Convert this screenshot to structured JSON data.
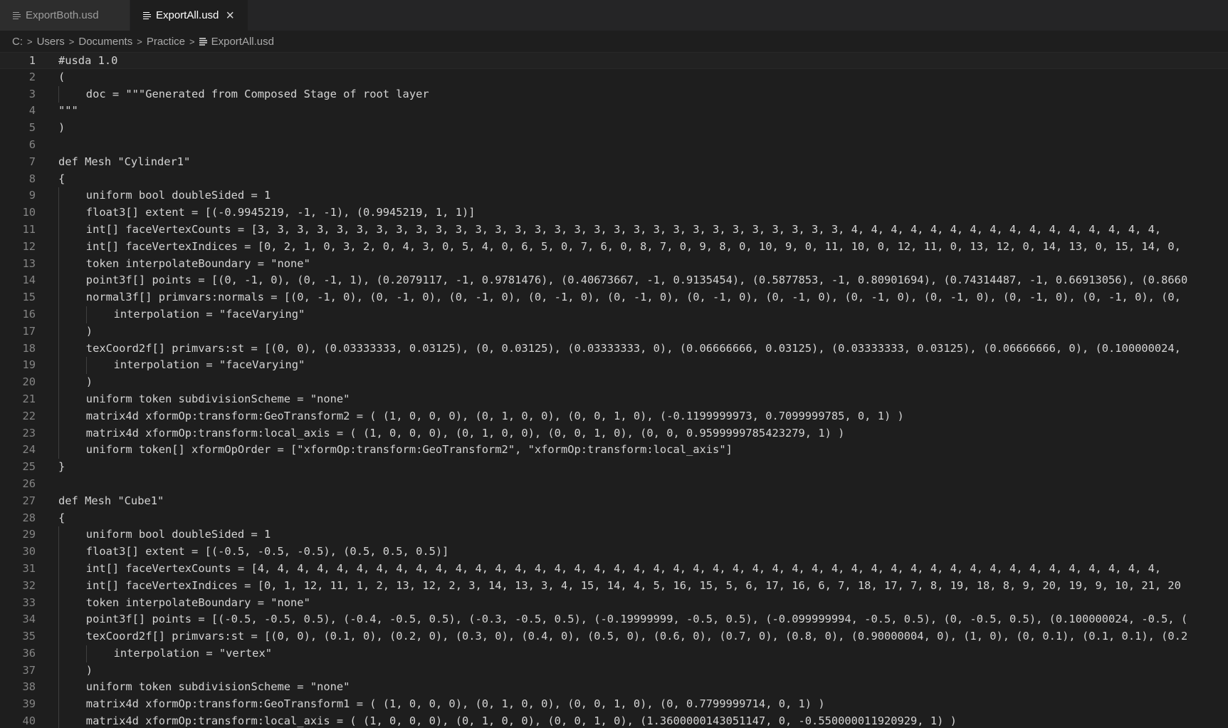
{
  "tabs": [
    {
      "label": "ExportBoth.usd",
      "active": false
    },
    {
      "label": "ExportAll.usd",
      "active": true
    }
  ],
  "breadcrumb": [
    "C:",
    "Users",
    "Documents",
    "Practice",
    "ExportAll.usd"
  ],
  "editor": {
    "current_line": 1,
    "lines": [
      {
        "n": "1",
        "indent": 0,
        "text": "#usda 1.0"
      },
      {
        "n": "2",
        "indent": 0,
        "text": "("
      },
      {
        "n": "3",
        "indent": 1,
        "text": "doc = \"\"\"Generated from Composed Stage of root layer"
      },
      {
        "n": "4",
        "indent": 0,
        "text": "\"\"\""
      },
      {
        "n": "5",
        "indent": 0,
        "text": ")"
      },
      {
        "n": "6",
        "indent": 0,
        "text": ""
      },
      {
        "n": "7",
        "indent": 0,
        "text": "def Mesh \"Cylinder1\""
      },
      {
        "n": "8",
        "indent": 0,
        "text": "{"
      },
      {
        "n": "9",
        "indent": 1,
        "text": "uniform bool doubleSided = 1"
      },
      {
        "n": "10",
        "indent": 1,
        "text": "float3[] extent = [(-0.9945219, -1, -1), (0.9945219, 1, 1)]"
      },
      {
        "n": "11",
        "indent": 1,
        "text": "int[] faceVertexCounts = [3, 3, 3, 3, 3, 3, 3, 3, 3, 3, 3, 3, 3, 3, 3, 3, 3, 3, 3, 3, 3, 3, 3, 3, 3, 3, 3, 3, 3, 3, 4, 4, 4, 4, 4, 4, 4, 4, 4, 4, 4, 4, 4, 4, 4, 4,"
      },
      {
        "n": "12",
        "indent": 1,
        "text": "int[] faceVertexIndices = [0, 2, 1, 0, 3, 2, 0, 4, 3, 0, 5, 4, 0, 6, 5, 0, 7, 6, 0, 8, 7, 0, 9, 8, 0, 10, 9, 0, 11, 10, 0, 12, 11, 0, 13, 12, 0, 14, 13, 0, 15, 14, 0,"
      },
      {
        "n": "13",
        "indent": 1,
        "text": "token interpolateBoundary = \"none\""
      },
      {
        "n": "14",
        "indent": 1,
        "text": "point3f[] points = [(0, -1, 0), (0, -1, 1), (0.2079117, -1, 0.9781476), (0.40673667, -1, 0.9135454), (0.5877853, -1, 0.80901694), (0.74314487, -1, 0.66913056), (0.8660"
      },
      {
        "n": "15",
        "indent": 1,
        "text": "normal3f[] primvars:normals = [(0, -1, 0), (0, -1, 0), (0, -1, 0), (0, -1, 0), (0, -1, 0), (0, -1, 0), (0, -1, 0), (0, -1, 0), (0, -1, 0), (0, -1, 0), (0, -1, 0), (0,"
      },
      {
        "n": "16",
        "indent": 2,
        "text": "interpolation = \"faceVarying\""
      },
      {
        "n": "17",
        "indent": 1,
        "text": ")"
      },
      {
        "n": "18",
        "indent": 1,
        "text": "texCoord2f[] primvars:st = [(0, 0), (0.03333333, 0.03125), (0, 0.03125), (0.03333333, 0), (0.06666666, 0.03125), (0.03333333, 0.03125), (0.06666666, 0), (0.100000024,"
      },
      {
        "n": "19",
        "indent": 2,
        "text": "interpolation = \"faceVarying\""
      },
      {
        "n": "20",
        "indent": 1,
        "text": ")"
      },
      {
        "n": "21",
        "indent": 1,
        "text": "uniform token subdivisionScheme = \"none\""
      },
      {
        "n": "22",
        "indent": 1,
        "text": "matrix4d xformOp:transform:GeoTransform2 = ( (1, 0, 0, 0), (0, 1, 0, 0), (0, 0, 1, 0), (-0.1199999973, 0.7099999785, 0, 1) )"
      },
      {
        "n": "23",
        "indent": 1,
        "text": "matrix4d xformOp:transform:local_axis = ( (1, 0, 0, 0), (0, 1, 0, 0), (0, 0, 1, 0), (0, 0, 0.9599999785423279, 1) )"
      },
      {
        "n": "24",
        "indent": 1,
        "text": "uniform token[] xformOpOrder = [\"xformOp:transform:GeoTransform2\", \"xformOp:transform:local_axis\"]"
      },
      {
        "n": "25",
        "indent": 0,
        "text": "}"
      },
      {
        "n": "26",
        "indent": 0,
        "text": ""
      },
      {
        "n": "27",
        "indent": 0,
        "text": "def Mesh \"Cube1\""
      },
      {
        "n": "28",
        "indent": 0,
        "text": "{"
      },
      {
        "n": "29",
        "indent": 1,
        "text": "uniform bool doubleSided = 1"
      },
      {
        "n": "30",
        "indent": 1,
        "text": "float3[] extent = [(-0.5, -0.5, -0.5), (0.5, 0.5, 0.5)]"
      },
      {
        "n": "31",
        "indent": 1,
        "text": "int[] faceVertexCounts = [4, 4, 4, 4, 4, 4, 4, 4, 4, 4, 4, 4, 4, 4, 4, 4, 4, 4, 4, 4, 4, 4, 4, 4, 4, 4, 4, 4, 4, 4, 4, 4, 4, 4, 4, 4, 4, 4, 4, 4, 4, 4, 4, 4, 4, 4,"
      },
      {
        "n": "32",
        "indent": 1,
        "text": "int[] faceVertexIndices = [0, 1, 12, 11, 1, 2, 13, 12, 2, 3, 14, 13, 3, 4, 15, 14, 4, 5, 16, 15, 5, 6, 17, 16, 6, 7, 18, 17, 7, 8, 19, 18, 8, 9, 20, 19, 9, 10, 21, 20"
      },
      {
        "n": "33",
        "indent": 1,
        "text": "token interpolateBoundary = \"none\""
      },
      {
        "n": "34",
        "indent": 1,
        "text": "point3f[] points = [(-0.5, -0.5, 0.5), (-0.4, -0.5, 0.5), (-0.3, -0.5, 0.5), (-0.19999999, -0.5, 0.5), (-0.099999994, -0.5, 0.5), (0, -0.5, 0.5), (0.100000024, -0.5, ("
      },
      {
        "n": "35",
        "indent": 1,
        "text": "texCoord2f[] primvars:st = [(0, 0), (0.1, 0), (0.2, 0), (0.3, 0), (0.4, 0), (0.5, 0), (0.6, 0), (0.7, 0), (0.8, 0), (0.90000004, 0), (1, 0), (0, 0.1), (0.1, 0.1), (0.2"
      },
      {
        "n": "36",
        "indent": 2,
        "text": "interpolation = \"vertex\""
      },
      {
        "n": "37",
        "indent": 1,
        "text": ")"
      },
      {
        "n": "38",
        "indent": 1,
        "text": "uniform token subdivisionScheme = \"none\""
      },
      {
        "n": "39",
        "indent": 1,
        "text": "matrix4d xformOp:transform:GeoTransform1 = ( (1, 0, 0, 0), (0, 1, 0, 0), (0, 0, 1, 0), (0, 0.7799999714, 0, 1) )"
      },
      {
        "n": "40",
        "indent": 1,
        "text": "matrix4d xformOp:transform:local_axis = ( (1, 0, 0, 0), (0, 1, 0, 0), (0, 0, 1, 0), (1.3600000143051147, 0, -0.550000011920929, 1) )"
      }
    ]
  },
  "colors": {
    "background": "#1e1e1e",
    "tabbar": "#252526",
    "text": "#d4d4d4",
    "line_number": "#858585"
  }
}
